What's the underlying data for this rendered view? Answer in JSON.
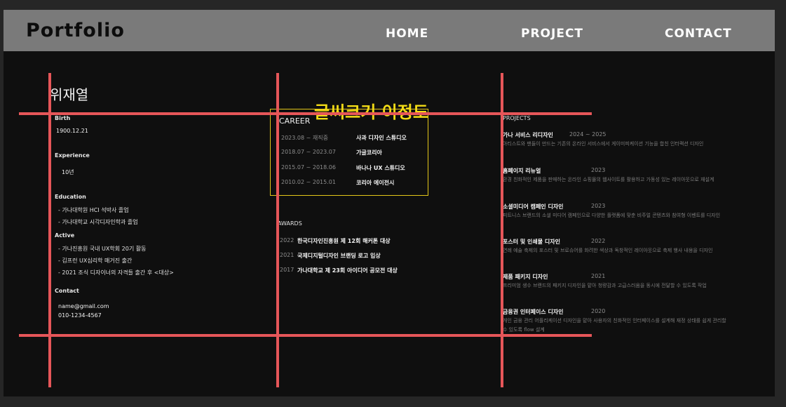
{
  "header": {
    "logo": "Portfolio",
    "nav": [
      "HOME",
      "PROJECT",
      "CONTACT"
    ]
  },
  "profile": {
    "name": "위재열",
    "birth_title": "Birth",
    "birth": "1900.12.21",
    "experience_title": "Experience",
    "experience": "10년",
    "education_title": "Education",
    "education": [
      "- 가나대학원 HCI 석박사 졸업",
      "- 가나대학교 시각디자인학과 졸업"
    ],
    "active_title": "Active",
    "active": [
      "- 가나진흥원 국내 UX학회 20기 활동",
      "- 김프런 UX심리학 매거진 출간",
      "- 2021 조식 디자이너의 자격들 출간 후 <대상>"
    ],
    "contact_title": "Contact",
    "email": "name@gmail.com",
    "phone": "010-1234-4567"
  },
  "career": {
    "title": "CAREER",
    "items": [
      {
        "period": "2023.08 ~ 재직중",
        "company": "사과 디자인 스튜디오"
      },
      {
        "period": "2018.07 ~ 2023.07",
        "company": "가글코리아"
      },
      {
        "period": "2015.07 ~ 2018.06",
        "company": "바나나 UX 스튜디오"
      },
      {
        "period": "2010.02 ~ 2015.01",
        "company": "코리아 에이전시"
      }
    ]
  },
  "awards": {
    "title": "AWARDS",
    "items": [
      {
        "year": "2022",
        "name": "한국디자인진흥원 제 12회 해커톤 대상"
      },
      {
        "year": "2021",
        "name": "국제디지털디자인 브랜딩 로고 입상"
      },
      {
        "year": "2017",
        "name": "가나대학교 제 23회 아이디어 공모전 대상"
      }
    ]
  },
  "projects": {
    "title": "PROJECTS",
    "items": [
      {
        "title": "가나 서비스 리디자인",
        "year": "2024 ~ 2025",
        "desc": "아티스트와 팬들이 만드는 기존의 온라인 서비스에서 게이미피케이션 기능을 합친 인터랙션 디자인"
      },
      {
        "title": "홈페이지 리뉴얼",
        "year": "2023",
        "desc": "환경 친화적인 제품을 판매하는 온라인 쇼핑몰의 웹사이트를 활용하고 가동성 있는 레이아웃으로 재설계"
      },
      {
        "title": "소셜미디어 캠페인 디자인",
        "year": "2023",
        "desc": "피트니스 브랜드의 소셜 미디어 캠페인으로 다양한 플랫폼에 맞춘 비주얼 콘텐츠와 참여형 이벤트를 디자인"
      },
      {
        "title": "포스터 및 인쇄물 디자인",
        "year": "2022",
        "desc": "연례 예술 축제의 포스터 및 브로슈어를 화려한 색상과 독창적인 레이아웃으로 축제 행사 내용을 디자인"
      },
      {
        "title": "제품 패키지 디자인",
        "year": "2021",
        "desc": "프리미엄 생수 브랜드의 패키지 디자인을 맡아 청량감과 고급스러움을 동시에 전달할 수 있도록 작업"
      },
      {
        "title": "금융권 인터페이스 디자인",
        "year": "2020",
        "desc": "개인 금융 관리 어플리케이션 디자인을 맡아 사용자의 친화적인 인터페이스를 설계해 재정 상태를 쉽게 관리할 수 있도록 flow 설계"
      }
    ]
  },
  "annotation": {
    "text": "글씨크기 이정도"
  },
  "colors": {
    "guide": "#e65659",
    "annotation": "#f2db16",
    "header": "#7a7a7a",
    "background": "#0f0f0f"
  }
}
